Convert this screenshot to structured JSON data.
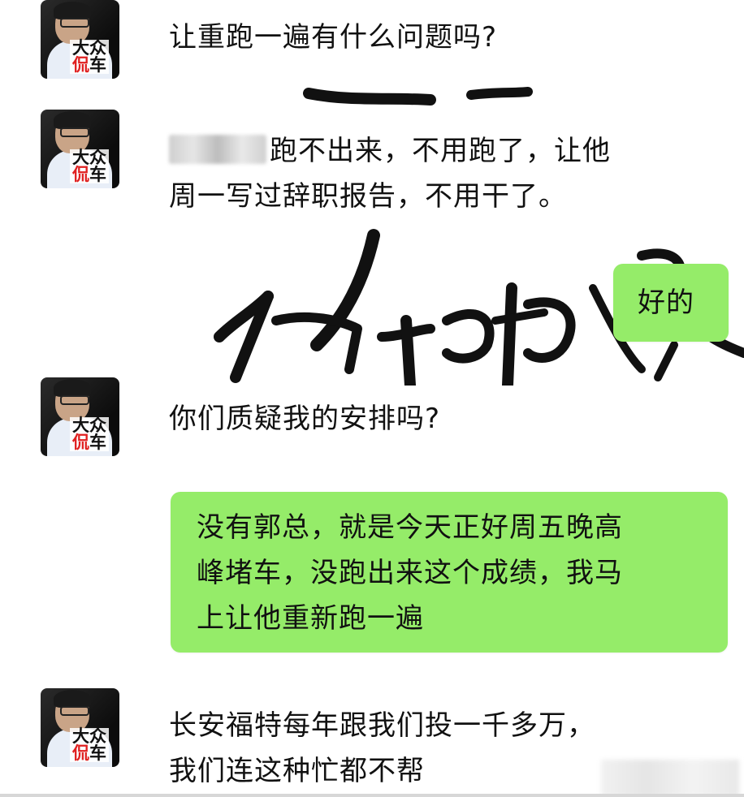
{
  "messages": [
    {
      "side": "left",
      "text": "让重跑一遍有什么问题吗?"
    },
    {
      "side": "left",
      "line1": "跑不出来，不用跑了，让他",
      "line2": "周一写过辞职报告，不用干了。"
    },
    {
      "side": "right",
      "text": "好的"
    },
    {
      "side": "left",
      "text": "你们质疑我的安排吗?"
    },
    {
      "side": "right",
      "line1": "没有郭总，就是今天正好周五晚高",
      "line2": "峰堵车，没跑出来这个成绩，我马",
      "line3": "上让他重新跑一遍"
    },
    {
      "side": "left",
      "line1": "长安福特每年跟我们投一千多万，",
      "line2": "我们连这种忙都不帮"
    }
  ],
  "avatar": {
    "line1": "大众",
    "line2_red": "侃",
    "line2_black": "车"
  },
  "colors": {
    "bubble_green": "#95ec69",
    "background": "#ffffff"
  }
}
